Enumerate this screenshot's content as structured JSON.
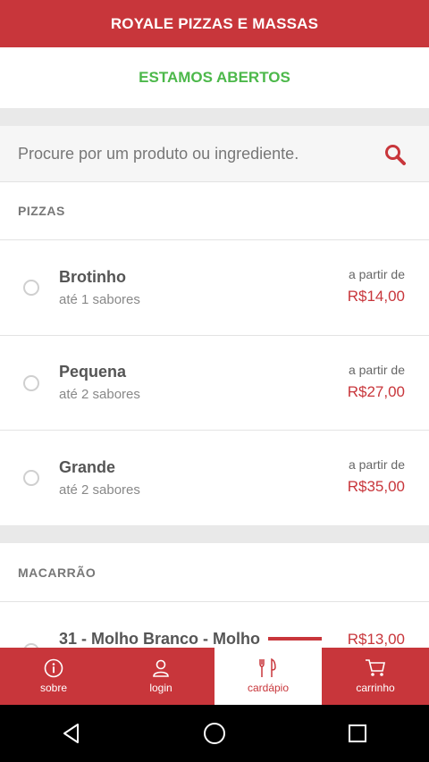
{
  "header": {
    "title": "ROYALE PIZZAS E MASSAS"
  },
  "status": {
    "text": "ESTAMOS ABERTOS"
  },
  "search": {
    "placeholder": "Procure por um produto ou ingrediente."
  },
  "sections": [
    {
      "title": "PIZZAS",
      "items": [
        {
          "name": "Brotinho",
          "sub": "até 1 sabores",
          "from": "a partir de",
          "price": "R$14,00"
        },
        {
          "name": "Pequena",
          "sub": "até 2 sabores",
          "from": "a partir de",
          "price": "R$27,00"
        },
        {
          "name": "Grande",
          "sub": "até 2 sabores",
          "from": "a partir de",
          "price": "R$35,00"
        }
      ]
    },
    {
      "title": "MACARRÃO",
      "items": [
        {
          "name": "31 - Molho Branco - Molho",
          "price": "R$13,00"
        }
      ]
    }
  ],
  "nav": [
    {
      "label": "sobre",
      "icon": "info-icon"
    },
    {
      "label": "login",
      "icon": "user-icon"
    },
    {
      "label": "cardápio",
      "icon": "utensils-icon",
      "active": true
    },
    {
      "label": "carrinho",
      "icon": "cart-icon"
    }
  ],
  "colors": {
    "brand": "#c8363b",
    "open": "#4cb84a"
  }
}
